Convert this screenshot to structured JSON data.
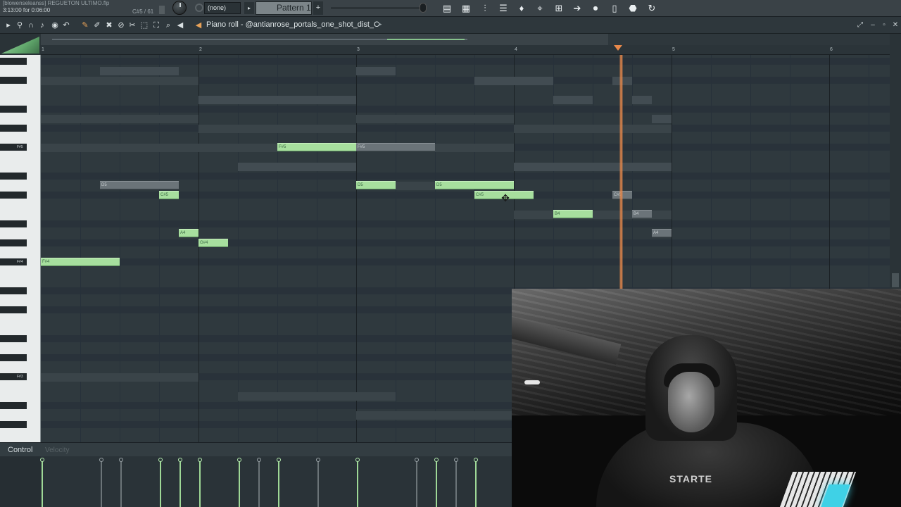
{
  "project": {
    "name": "[blowenseleanss] REGUETON ULTIMO.flp",
    "time": "3:13:00 for 0:06:00",
    "hint": "C#5 / 61"
  },
  "toolbar": {
    "snap_value": "(none)",
    "pattern_name": "Pattern 1",
    "pattern_add": "+",
    "snap_arrow": "▸"
  },
  "piano_roll": {
    "title": "Piano roll - @antianrose_portals_one_shot_dist_C",
    "title_arrow": "▸",
    "bars": [
      "1",
      "2",
      "3",
      "4",
      "5",
      "6"
    ],
    "key_labels": [
      "F#5",
      "F#4",
      "F#3"
    ]
  },
  "notes": [
    {
      "label": "F#5"
    },
    {
      "label": "F#5"
    },
    {
      "label": "D5"
    },
    {
      "label": "C#5"
    },
    {
      "label": "D5"
    },
    {
      "label": "D5"
    },
    {
      "label": "C#5"
    },
    {
      "label": "C#5"
    },
    {
      "label": "B4"
    },
    {
      "label": "B4"
    },
    {
      "label": "A4"
    },
    {
      "label": "G#4"
    },
    {
      "label": "A4"
    },
    {
      "label": "F#4"
    }
  ],
  "control": {
    "label": "Control",
    "velocity_label": "Velocity"
  },
  "webcam": {
    "shirt_text": "STARTE"
  },
  "colors": {
    "note_green": "#a7df9e",
    "playhead": "#e7884a",
    "grid_bg": "#2f393e"
  }
}
